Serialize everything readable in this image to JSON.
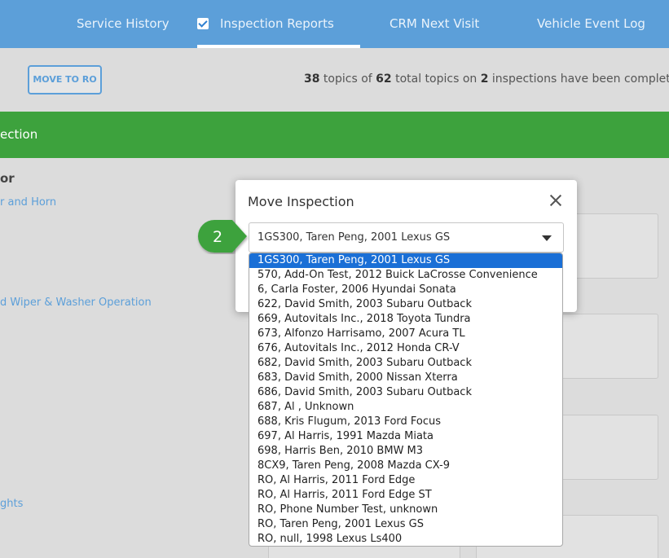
{
  "nav": {
    "tabs": [
      {
        "label": "Service History"
      },
      {
        "label": "Inspection Reports"
      },
      {
        "label": "CRM Next Visit"
      },
      {
        "label": "Vehicle Event Log"
      }
    ]
  },
  "toolbar": {
    "move_to_ro": "MOVE TO RO",
    "summary": {
      "done": "38",
      "text1": " topics of ",
      "total": "62",
      "text2": " total topics on ",
      "inspections": "2",
      "text3": " inspections have been complete"
    }
  },
  "section": {
    "banner": "ection",
    "group_title": "or",
    "links": [
      "r and Horn",
      "d Wiper & Washer Operation",
      "ghts"
    ]
  },
  "modal": {
    "title": "Move Inspection",
    "selected_value": "1GS300, Taren Peng, 2001 Lexus GS"
  },
  "callout": {
    "number": "2",
    "color": "#3da23d"
  },
  "dropdown": {
    "options": [
      "1GS300, Taren Peng, 2001 Lexus GS",
      "570, Add-On Test, 2012 Buick LaCrosse Convenience",
      "6, Carla Foster, 2006 Hyundai Sonata",
      "622, David Smith, 2003 Subaru Outback",
      "669, Autovitals Inc., 2018 Toyota Tundra",
      "673, Alfonzo Harrisamo, 2007 Acura TL",
      "676, Autovitals Inc., 2012 Honda CR-V",
      "682, David Smith, 2003 Subaru Outback",
      "683, David Smith, 2000 Nissan Xterra",
      "686, David Smith, 2003 Subaru Outback",
      "687, Al , Unknown",
      "688, Kris Flugum, 2013 Ford Focus",
      "697, Al Harris, 1991 Mazda Miata",
      "698, Harris Ben, 2010 BMW M3",
      "8CX9, Taren Peng, 2008 Mazda CX-9",
      "RO, Al Harris, 2011 Ford Edge",
      "RO, Al Harris, 2011 Ford Edge ST",
      "RO, Phone Number Test, unknown",
      "RO, Taren Peng, 2001 Lexus GS",
      "RO, null, 1998 Lexus Ls400"
    ]
  }
}
